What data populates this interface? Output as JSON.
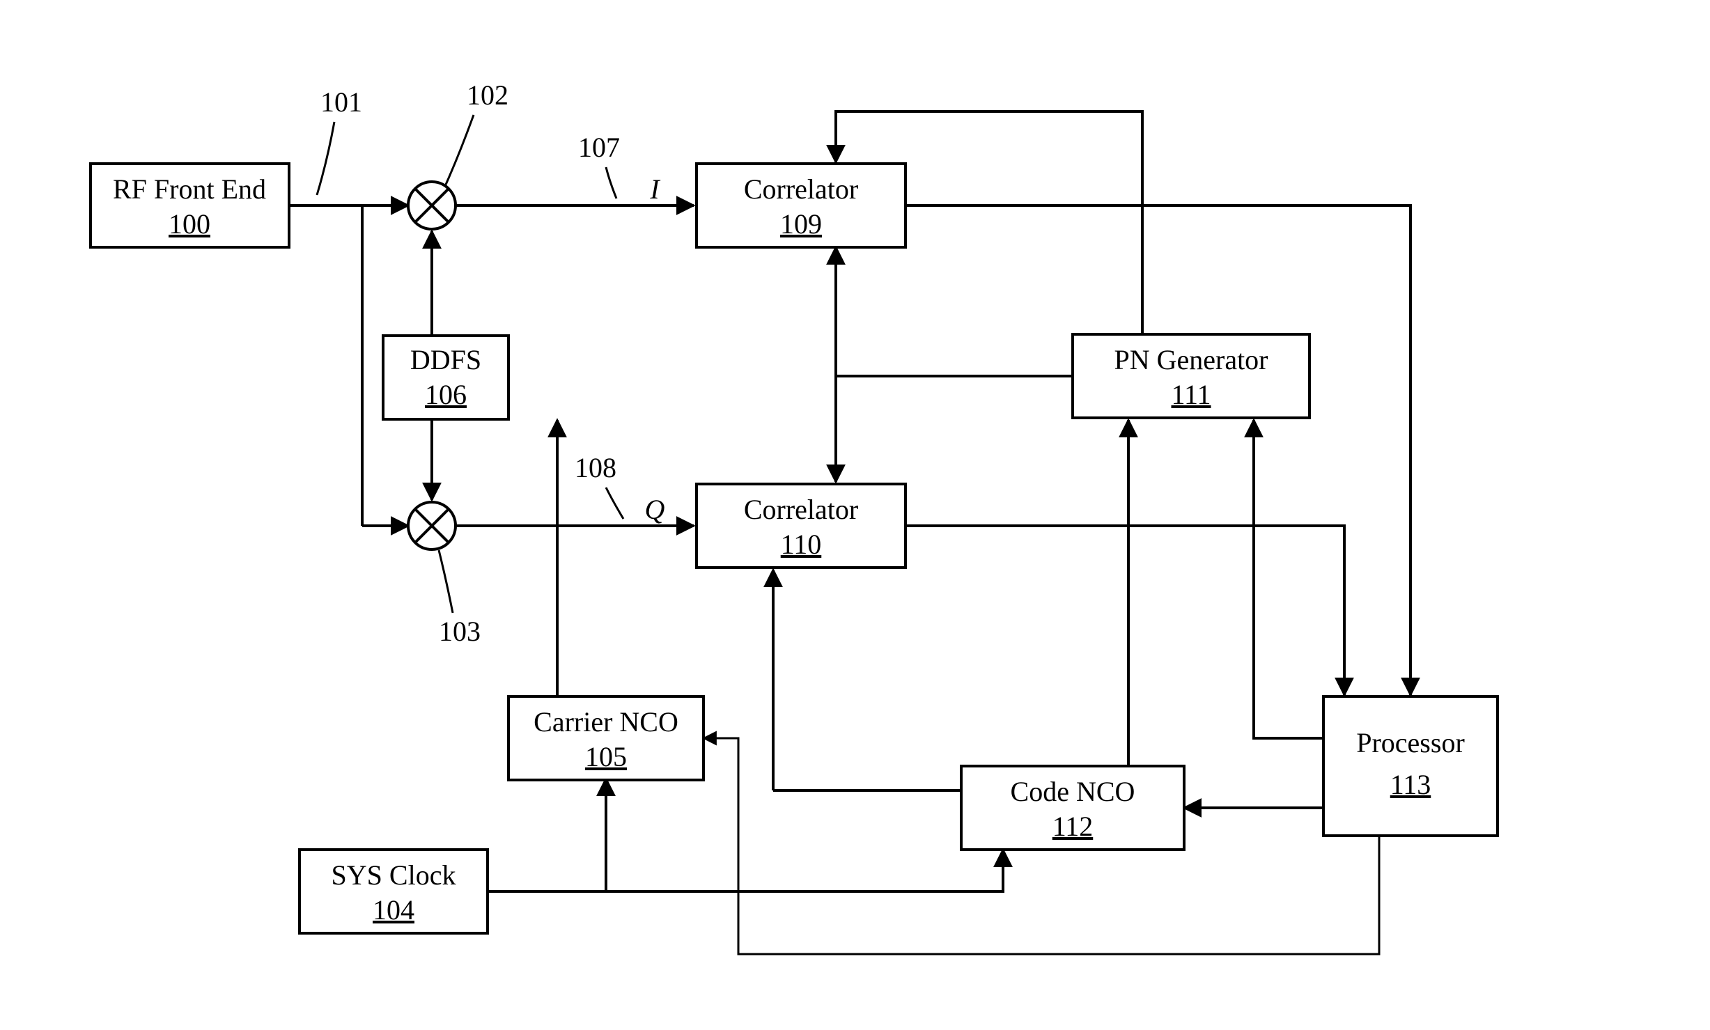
{
  "blocks": {
    "rf": {
      "label": "RF Front End",
      "id": "100"
    },
    "sys": {
      "label": "SYS Clock",
      "id": "104"
    },
    "carrier": {
      "label": "Carrier NCO",
      "id": "105"
    },
    "ddfs": {
      "label": "DDFS",
      "id": "106"
    },
    "corr1": {
      "label": "Correlator",
      "id": "109"
    },
    "corr2": {
      "label": "Correlator",
      "id": "110"
    },
    "pn": {
      "label": "PN Generator",
      "id": "111"
    },
    "codenco": {
      "label": "Code NCO",
      "id": "112"
    },
    "proc": {
      "label": "Processor",
      "id": "113"
    }
  },
  "callouts": {
    "c101": "101",
    "c102": "102",
    "c103": "103",
    "c107": "107",
    "c108": "108"
  },
  "signals": {
    "I": "I",
    "Q": "Q"
  }
}
